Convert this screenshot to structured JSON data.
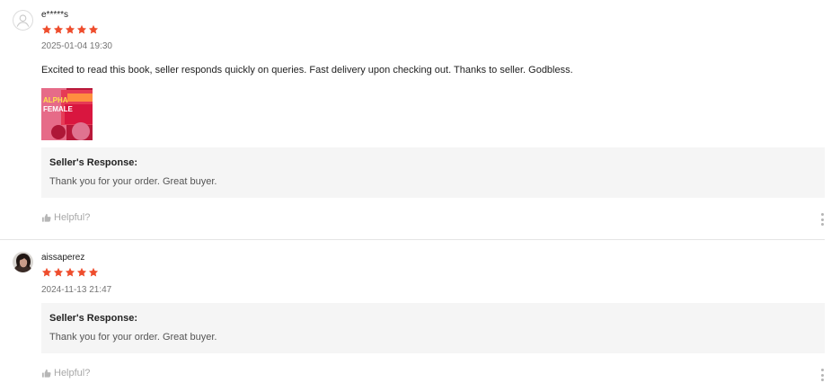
{
  "reviews": [
    {
      "username": "e*****s",
      "rating": 5,
      "timestamp": "2025-01-04 19:30",
      "comment": "Excited to read this book, seller responds quickly on queries. Fast delivery upon checking out. Thanks to seller. Godbless.",
      "image_text": "ALPHA FEMALE",
      "seller_response": {
        "title": "Seller's Response:",
        "text": "Thank you for your order. Great buyer."
      },
      "helpful_label": "Helpful?"
    },
    {
      "username": "aissaperez",
      "rating": 5,
      "timestamp": "2024-11-13 21:47",
      "seller_response": {
        "title": "Seller's Response:",
        "text": "Thank you for your order. Great buyer."
      },
      "helpful_label": "Helpful?"
    }
  ],
  "colors": {
    "star": "#ee4d2d",
    "seller_box": "#f5f5f5",
    "muted": "#a8a8a8"
  },
  "icons": [
    "default-avatar-icon",
    "user-photo-avatar",
    "star-icon",
    "thumbs-up-icon",
    "more-options-icon"
  ]
}
